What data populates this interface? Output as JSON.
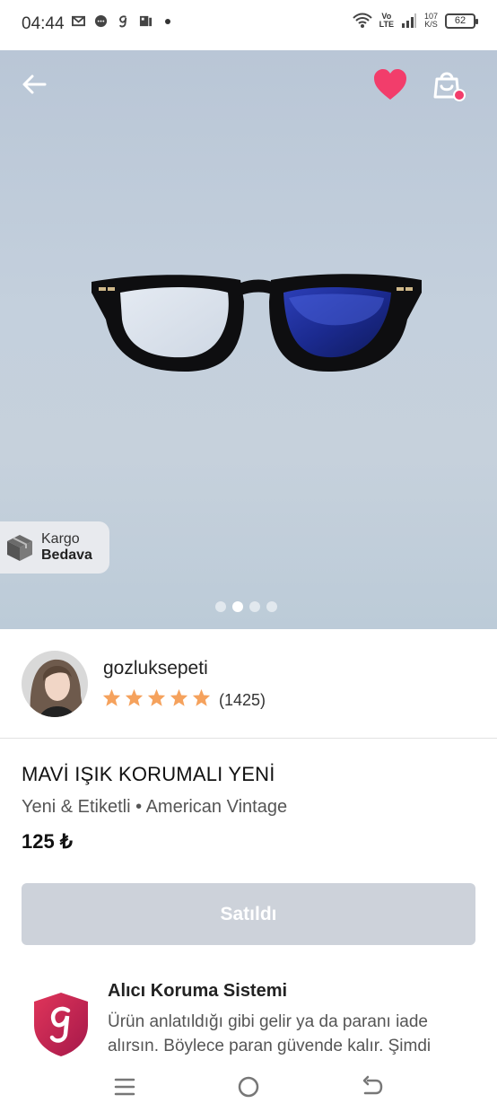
{
  "status_bar": {
    "time": "04:44",
    "network": "Vo\nLTE",
    "speed_value": "107",
    "speed_unit": "K/S",
    "battery": "62"
  },
  "hero": {
    "badge_line1": "Kargo",
    "badge_line2": "Bedava",
    "carousel_total": 4,
    "carousel_active": 2
  },
  "seller": {
    "name": "gozluksepeti",
    "rating_stars": 5,
    "rating_count": "(1425)"
  },
  "product": {
    "title": "MAVİ IŞIK KORUMALI YENİ",
    "subtitle": "Yeni & Etiketli • American Vintage",
    "price": "125 ₺",
    "sold_label": "Satıldı"
  },
  "protection": {
    "title": "Alıcı Koruma Sistemi",
    "text": "Ürün anlatıldığı gibi gelir ya da paranı iade alırsın. Böylece paran güvende kalır. Şimdi"
  },
  "colors": {
    "accent_pink": "#f23d6b",
    "star_orange": "#f5a25d",
    "sold_gray": "#cdd2da",
    "shield_red": "#c8244f"
  }
}
